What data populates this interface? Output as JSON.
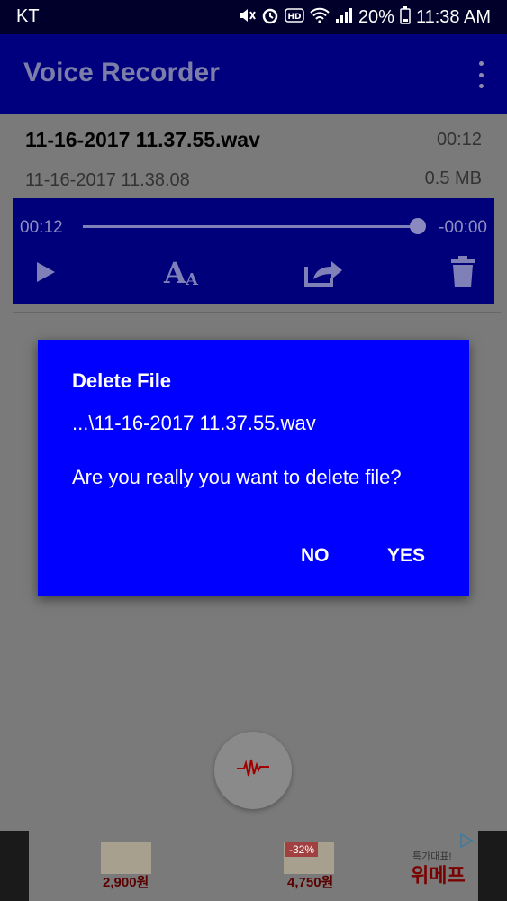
{
  "status_bar": {
    "carrier": "KT",
    "battery": "20%",
    "time": "11:38 AM",
    "icons": [
      "mute-icon",
      "alarm-icon",
      "hd-icon",
      "wifi-icon",
      "signal-icon",
      "battery-icon"
    ]
  },
  "app_bar": {
    "title": "Voice Recorder",
    "menu_icon": "more-vert-icon"
  },
  "recording": {
    "file_name": "11-16-2017 11.37.55.wav",
    "duration": "00:12",
    "date": "11-16-2017 11.38.08",
    "size": "0.5 MB"
  },
  "player": {
    "current_time": "00:12",
    "remaining_time": "-00:00",
    "progress": 1.0,
    "controls": [
      "play-icon",
      "text-size-icon",
      "share-icon",
      "delete-icon"
    ]
  },
  "dialog": {
    "title": "Delete File",
    "path": "...\\11-16-2017 11.37.55.wav",
    "message": "Are you really you want to delete file?",
    "no_label": "NO",
    "yes_label": "YES"
  },
  "fab": {
    "icon": "waveform-icon"
  },
  "ad": {
    "price_1": "2,900원",
    "discount_badge": "-32%",
    "price_2": "4,750원",
    "brand_tagline": "특가대표!",
    "brand": "위메프"
  },
  "colors": {
    "app_bar": "#00007f",
    "dialog": "#0000ff",
    "overlay_background": "#7a7a7a",
    "accent_wave": "#c00000"
  }
}
